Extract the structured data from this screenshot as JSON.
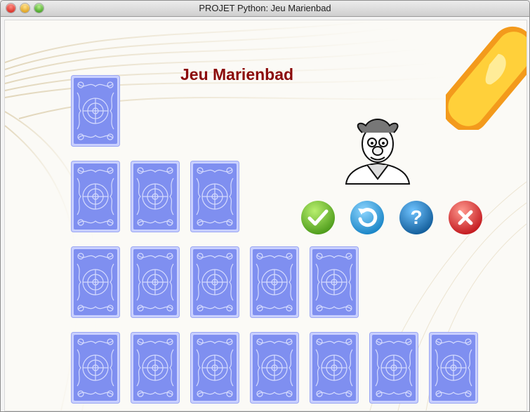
{
  "window": {
    "title": "PROJET Python: Jeu Marienbad"
  },
  "game": {
    "title": "Jeu Marienbad",
    "rows": [
      1,
      3,
      5,
      7
    ]
  },
  "icons": {
    "validate": "checkmark-icon",
    "undo": "undo-icon",
    "help": "help-icon",
    "quit": "close-icon",
    "mascot": "professor-icon",
    "decoration": "pencil-icon"
  },
  "colors": {
    "title": "#8b0a0a",
    "card": "#7f8ff0",
    "validate": "#6cc02c",
    "undo": "#2fa3df",
    "help": "#1e7fc4",
    "quit": "#df3335"
  }
}
